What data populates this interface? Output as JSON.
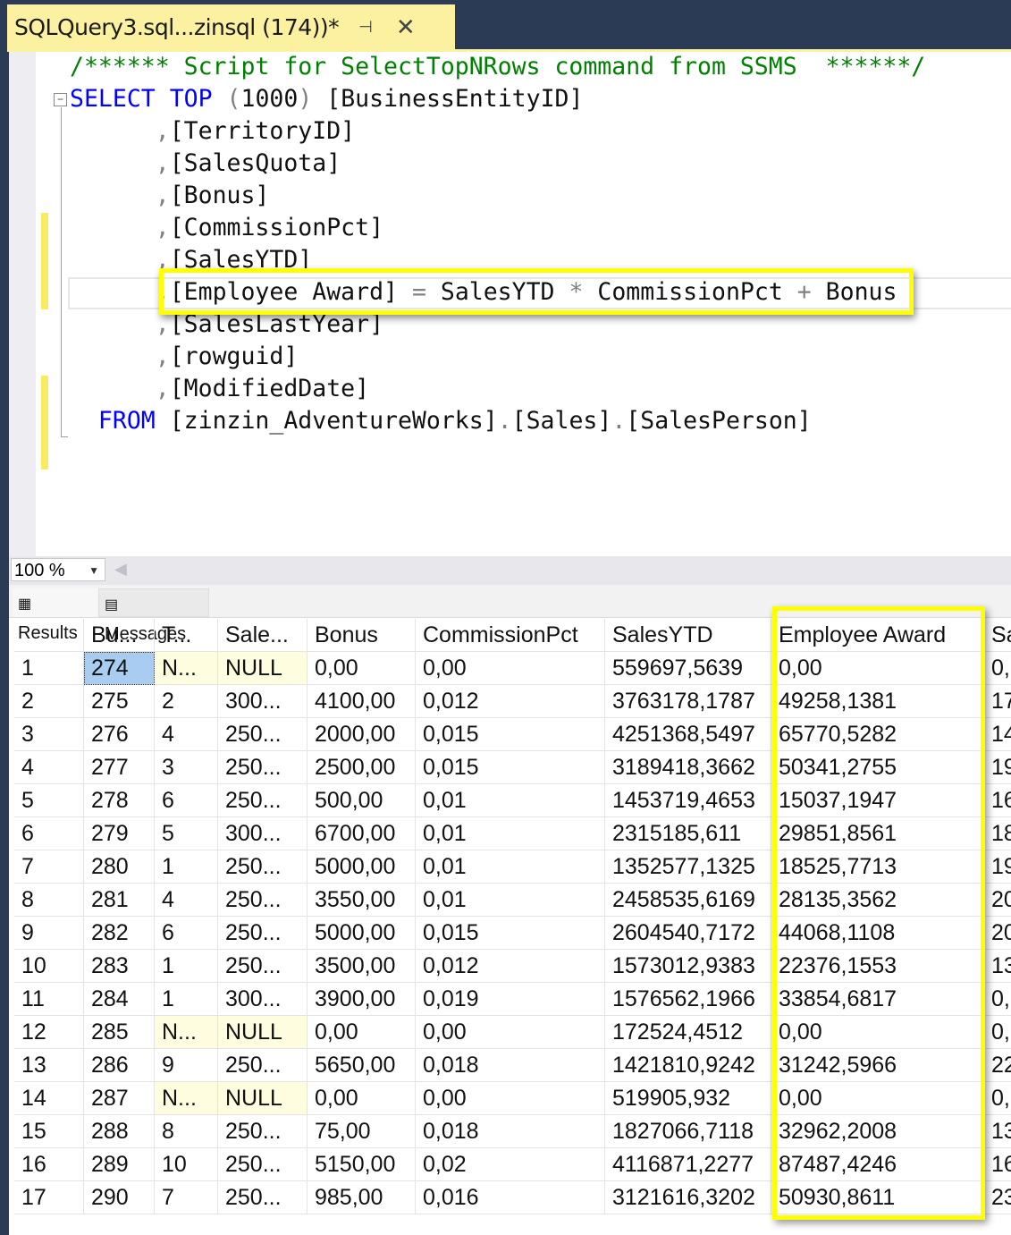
{
  "document_tab": {
    "title": "SQLQuery3.sql...zinsql (174))*",
    "pin_icon": "⊣",
    "close_icon": "✕"
  },
  "editor": {
    "lines": [
      [
        {
          "t": "/****** Script for SelectTopNRows command from SSMS  ******/",
          "c": "cm"
        }
      ],
      [
        {
          "t": "SELECT",
          "c": "kw"
        },
        {
          "t": " ",
          "c": "tx"
        },
        {
          "t": "TOP",
          "c": "kw"
        },
        {
          "t": " ",
          "c": "tx"
        },
        {
          "t": "(",
          "c": "gr"
        },
        {
          "t": "1000",
          "c": "tx"
        },
        {
          "t": ")",
          "c": "gr"
        },
        {
          "t": " [BusinessEntityID]",
          "c": "tx"
        }
      ],
      [
        {
          "t": "      ",
          "c": "tx"
        },
        {
          "t": ",",
          "c": "gr"
        },
        {
          "t": "[TerritoryID]",
          "c": "tx"
        }
      ],
      [
        {
          "t": "      ",
          "c": "tx"
        },
        {
          "t": ",",
          "c": "gr"
        },
        {
          "t": "[SalesQuota]",
          "c": "tx"
        }
      ],
      [
        {
          "t": "      ",
          "c": "tx"
        },
        {
          "t": ",",
          "c": "gr"
        },
        {
          "t": "[Bonus]",
          "c": "tx"
        }
      ],
      [
        {
          "t": "      ",
          "c": "tx"
        },
        {
          "t": ",",
          "c": "gr"
        },
        {
          "t": "[CommissionPct]",
          "c": "tx"
        }
      ],
      [
        {
          "t": "      ",
          "c": "tx"
        },
        {
          "t": ",",
          "c": "gr"
        },
        {
          "t": "[SalesYTD]",
          "c": "tx"
        }
      ],
      [
        {
          "t": "      ",
          "c": "tx"
        },
        {
          "t": ",",
          "c": "gr"
        },
        {
          "t": "[Employee Award] ",
          "c": "tx"
        },
        {
          "t": "=",
          "c": "gr"
        },
        {
          "t": " SalesYTD ",
          "c": "tx"
        },
        {
          "t": "*",
          "c": "gr"
        },
        {
          "t": " CommissionPct ",
          "c": "tx"
        },
        {
          "t": "+",
          "c": "gr"
        },
        {
          "t": " Bonus",
          "c": "tx"
        }
      ],
      [
        {
          "t": "      ",
          "c": "tx"
        },
        {
          "t": ",",
          "c": "gr"
        },
        {
          "t": "[SalesLastYear]",
          "c": "tx"
        }
      ],
      [
        {
          "t": "      ",
          "c": "tx"
        },
        {
          "t": ",",
          "c": "gr"
        },
        {
          "t": "[rowguid]",
          "c": "tx"
        }
      ],
      [
        {
          "t": "      ",
          "c": "tx"
        },
        {
          "t": ",",
          "c": "gr"
        },
        {
          "t": "[ModifiedDate]",
          "c": "tx"
        }
      ],
      [
        {
          "t": "  ",
          "c": "tx"
        },
        {
          "t": "FROM",
          "c": "kw"
        },
        {
          "t": " [zinzin_AdventureWorks]",
          "c": "tx"
        },
        {
          "t": ".",
          "c": "gr"
        },
        {
          "t": "[Sales]",
          "c": "tx"
        },
        {
          "t": ".",
          "c": "gr"
        },
        {
          "t": "[SalesPerson]",
          "c": "tx"
        }
      ]
    ]
  },
  "zoom": {
    "value": "100 %"
  },
  "result_tabs": {
    "results": "Results",
    "messages": "Messages"
  },
  "grid": {
    "headers": [
      "",
      "Bu...",
      "T...",
      "Sale...",
      "Bonus",
      "CommissionPct",
      "SalesYTD",
      "Employee Award",
      "Sa"
    ],
    "rows": [
      [
        "1",
        "274",
        "N...",
        "NULL",
        "0,00",
        "0,00",
        "559697,5639",
        "0,00",
        "0,"
      ],
      [
        "2",
        "275",
        "2",
        "300...",
        "4100,00",
        "0,012",
        "3763178,1787",
        "49258,1381",
        "17"
      ],
      [
        "3",
        "276",
        "4",
        "250...",
        "2000,00",
        "0,015",
        "4251368,5497",
        "65770,5282",
        "14"
      ],
      [
        "4",
        "277",
        "3",
        "250...",
        "2500,00",
        "0,015",
        "3189418,3662",
        "50341,2755",
        "19"
      ],
      [
        "5",
        "278",
        "6",
        "250...",
        "500,00",
        "0,01",
        "1453719,4653",
        "15037,1947",
        "16"
      ],
      [
        "6",
        "279",
        "5",
        "300...",
        "6700,00",
        "0,01",
        "2315185,611",
        "29851,8561",
        "18"
      ],
      [
        "7",
        "280",
        "1",
        "250...",
        "5000,00",
        "0,01",
        "1352577,1325",
        "18525,7713",
        "19"
      ],
      [
        "8",
        "281",
        "4",
        "250...",
        "3550,00",
        "0,01",
        "2458535,6169",
        "28135,3562",
        "20"
      ],
      [
        "9",
        "282",
        "6",
        "250...",
        "5000,00",
        "0,015",
        "2604540,7172",
        "44068,1108",
        "20"
      ],
      [
        "10",
        "283",
        "1",
        "250...",
        "3500,00",
        "0,012",
        "1573012,9383",
        "22376,1553",
        "13"
      ],
      [
        "11",
        "284",
        "1",
        "300...",
        "3900,00",
        "0,019",
        "1576562,1966",
        "33854,6817",
        "0,"
      ],
      [
        "12",
        "285",
        "N...",
        "NULL",
        "0,00",
        "0,00",
        "172524,4512",
        "0,00",
        "0,"
      ],
      [
        "13",
        "286",
        "9",
        "250...",
        "5650,00",
        "0,018",
        "1421810,9242",
        "31242,5966",
        "22"
      ],
      [
        "14",
        "287",
        "N...",
        "NULL",
        "0,00",
        "0,00",
        "519905,932",
        "0,00",
        "0,"
      ],
      [
        "15",
        "288",
        "8",
        "250...",
        "75,00",
        "0,018",
        "1827066,7118",
        "32962,2008",
        "13"
      ],
      [
        "16",
        "289",
        "10",
        "250...",
        "5150,00",
        "0,02",
        "4116871,2277",
        "87487,4246",
        "16"
      ],
      [
        "17",
        "290",
        "7",
        "250...",
        "985,00",
        "0,016",
        "3121616,3202",
        "50930,8611",
        "23"
      ]
    ]
  },
  "colors": {
    "highlight": "#ffff00",
    "keyword": "#0000ff",
    "comment": "#008000",
    "selection": "#a9cdf0",
    "null_cell": "#fffde0",
    "tab": "#fcf1a0"
  }
}
